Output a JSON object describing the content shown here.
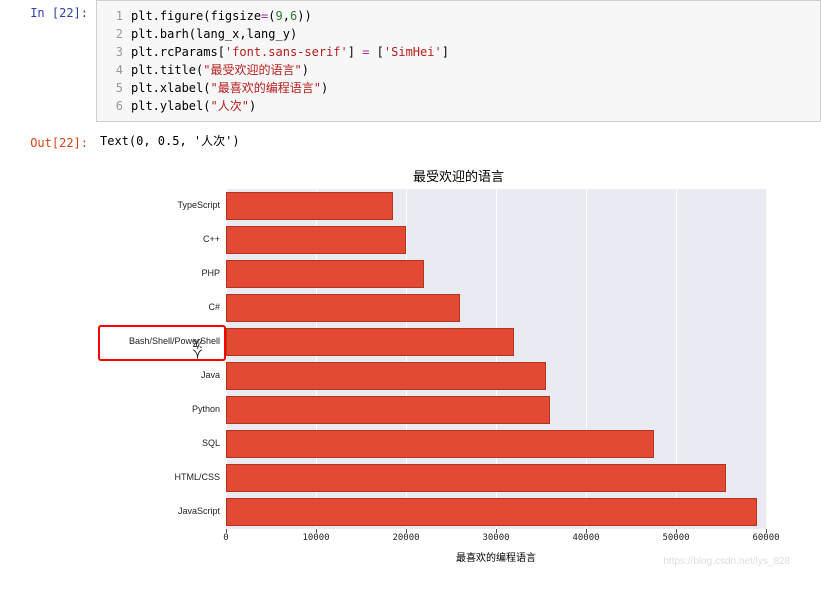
{
  "cell": {
    "in_prompt": "In [22]:",
    "out_prompt": "Out[22]:",
    "code_lines": [
      {
        "n": "1",
        "txt": "plt.figure(figsize=(9,6))"
      },
      {
        "n": "2",
        "txt": "plt.barh(lang_x,lang_y)"
      },
      {
        "n": "3",
        "txt": "plt.rcParams['font.sans-serif'] = ['SimHei']"
      },
      {
        "n": "4",
        "txt": "plt.title(\"最受欢迎的语言\")"
      },
      {
        "n": "5",
        "txt": "plt.xlabel(\"最喜欢的编程语言\")"
      },
      {
        "n": "6",
        "txt": "plt.ylabel(\"人次\")"
      }
    ],
    "output_text": "Text(0, 0.5, '人次')"
  },
  "chart_data": {
    "type": "bar",
    "orientation": "horizontal",
    "title": "最受欢迎的语言",
    "xlabel": "最喜欢的编程语言",
    "ylabel": "人次",
    "categories": [
      "TypeScript",
      "C++",
      "PHP",
      "C#",
      "Bash/Shell/PowerShell",
      "Java",
      "Python",
      "SQL",
      "HTML/CSS",
      "JavaScript"
    ],
    "values": [
      18500,
      20000,
      22000,
      26000,
      32000,
      35500,
      36000,
      47500,
      55500,
      59000
    ],
    "xlim": [
      0,
      60000
    ],
    "xticks": [
      0,
      10000,
      20000,
      30000,
      40000,
      50000,
      60000
    ],
    "bar_color": "#E24A33",
    "grid": true,
    "highlighted_category": "Bash/Shell/PowerShell"
  },
  "watermark": "https://blog.csdn.net/lys_828"
}
